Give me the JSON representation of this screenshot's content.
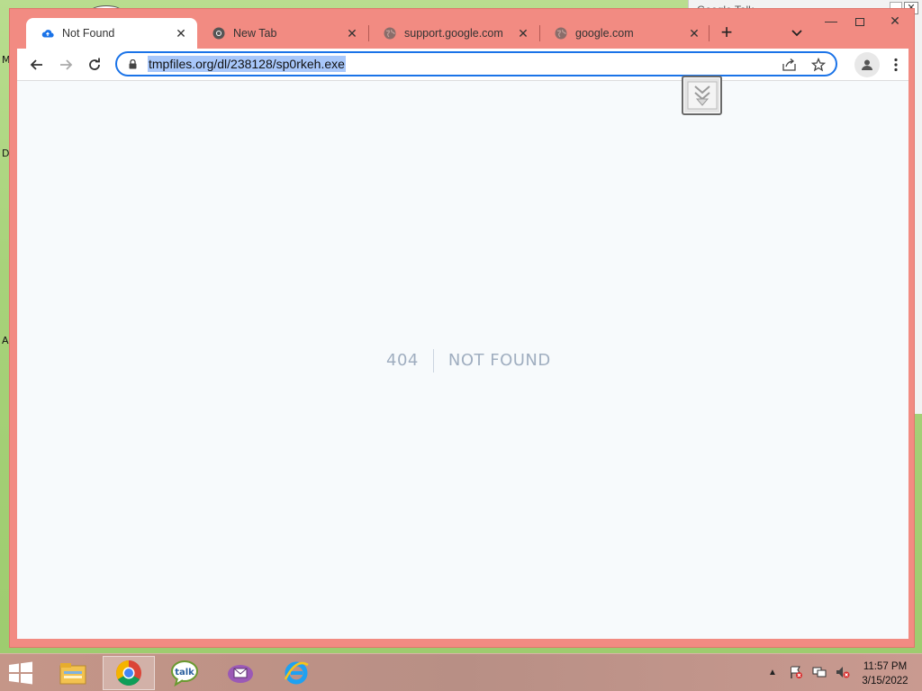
{
  "desktop": {
    "bg_window_title": "Google Talk",
    "side_letters": [
      "M",
      "D",
      "A"
    ]
  },
  "browser": {
    "tabs": [
      {
        "title": "Not Found",
        "icon": "cloud-upload-icon",
        "active": true
      },
      {
        "title": "New Tab",
        "icon": "chrome-icon",
        "active": false
      },
      {
        "title": "support.google.com",
        "icon": "globe-icon",
        "active": false
      },
      {
        "title": "google.com",
        "icon": "globe-icon",
        "active": false
      }
    ],
    "url": "tmpfiles.org/dl/238128/sp0rkeh.exe",
    "accent_color": "#f28b82"
  },
  "page": {
    "code": "404",
    "message": "NOT FOUND"
  },
  "taskbar": {
    "time": "11:57 PM",
    "date": "3/15/2022",
    "apps": [
      "file-explorer-icon",
      "chrome-icon",
      "google-talk-icon",
      "mail-icon",
      "internet-explorer-icon"
    ]
  }
}
